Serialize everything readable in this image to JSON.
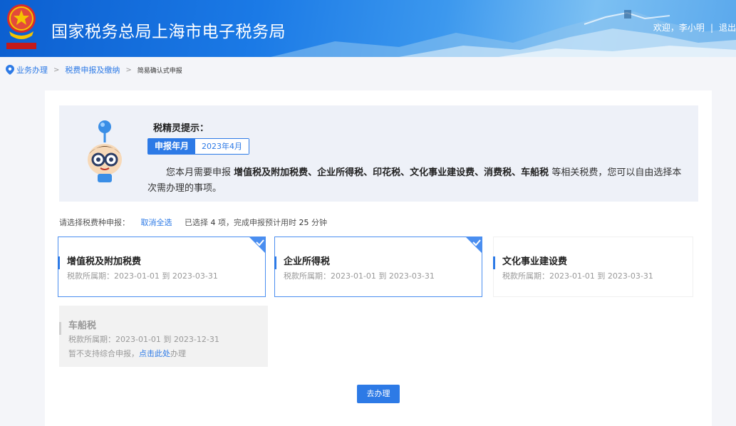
{
  "header": {
    "title": "国家税务总局上海市电子税务局",
    "welcome": "欢迎，李小明",
    "separator": "|",
    "logout": "退出"
  },
  "breadcrumb": {
    "items": [
      "业务办理",
      "税费申报及缴纳"
    ],
    "arrow": ">",
    "current": "简易确认式申报"
  },
  "tip": {
    "title": "税精灵提示：",
    "period_label": "申报年月",
    "period_value": "2023年4月",
    "text_prefix": "您本月需要申报",
    "text_taxes": "增值税及附加税费、企业所得税、印花税、文化事业建设费、消费税、车船税",
    "text_suffix": "等相关税费，您可以自由选择本次需办理的事项。"
  },
  "selection": {
    "label": "请选择税费种申报：",
    "cancel_all": "取消全选",
    "summary_prefix": "已选择",
    "selected_count": "4",
    "summary_mid": "项，完成申报预计用时",
    "minutes": "25",
    "summary_suffix": "分钟"
  },
  "cards": [
    {
      "name": "增值税及附加税费",
      "period": "税款所属期：2023-01-01 到 2023-03-31",
      "selected": true
    },
    {
      "name": "企业所得税",
      "period": "税款所属期：2023-01-01 到 2023-03-31",
      "selected": true
    },
    {
      "name": "文化事业建设费",
      "period": "税款所属期：2023-01-01 到 2023-03-31",
      "selected": false
    },
    {
      "name": "车船税",
      "period": "税款所属期：2023-01-01 到 2023-12-31",
      "disabled": true,
      "note_prefix": "暂不支持综合申报，",
      "note_link": "点击此处",
      "note_suffix": "办理"
    }
  ],
  "go_button": "去办理",
  "colors": {
    "accent": "#2d7ae6",
    "header_start": "#0c5fd0",
    "tip_bg": "#eef1f8"
  }
}
